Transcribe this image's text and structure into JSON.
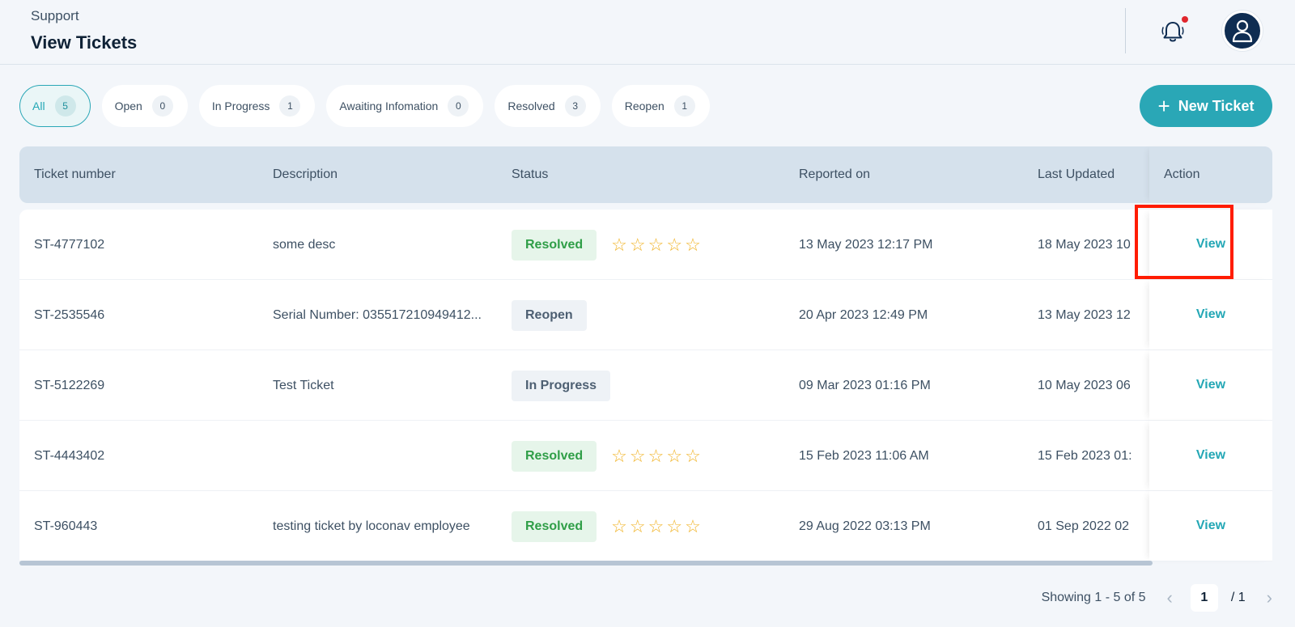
{
  "header": {
    "breadcrumb": "Support",
    "title": "View Tickets",
    "notification_icon": "bell-icon",
    "avatar_icon": "user-icon"
  },
  "filters": [
    {
      "label": "All",
      "count": "5",
      "active": true
    },
    {
      "label": "Open",
      "count": "0",
      "active": false
    },
    {
      "label": "In Progress",
      "count": "1",
      "active": false
    },
    {
      "label": "Awaiting Infomation",
      "count": "0",
      "active": false
    },
    {
      "label": "Resolved",
      "count": "3",
      "active": false
    },
    {
      "label": "Reopen",
      "count": "1",
      "active": false
    }
  ],
  "new_ticket_label": "New Ticket",
  "table": {
    "columns": [
      "Ticket number",
      "Description",
      "Status",
      "Reported on",
      "Last Updated",
      "Action"
    ],
    "rows": [
      {
        "number": "ST-4777102",
        "description": "some desc",
        "status": "Resolved",
        "rating_stars": 5,
        "reported": "13 May 2023 12:17 PM",
        "updated": "18 May 2023 10",
        "action": "View"
      },
      {
        "number": "ST-2535546",
        "description": "Serial Number: 035517210949412...",
        "status": "Reopen",
        "rating_stars": 0,
        "reported": "20 Apr 2023 12:49 PM",
        "updated": "13 May 2023 12",
        "action": "View"
      },
      {
        "number": "ST-5122269",
        "description": "Test Ticket",
        "status": "In Progress",
        "rating_stars": 0,
        "reported": "09 Mar 2023 01:16 PM",
        "updated": "10 May 2023 06",
        "action": "View"
      },
      {
        "number": "ST-4443402",
        "description": "",
        "status": "Resolved",
        "rating_stars": 5,
        "reported": "15 Feb 2023 11:06 AM",
        "updated": "15 Feb 2023 01:",
        "action": "View"
      },
      {
        "number": "ST-960443",
        "description": "testing ticket by loconav employee",
        "status": "Resolved",
        "rating_stars": 5,
        "reported": "29 Aug 2022 03:13 PM",
        "updated": "01 Sep 2022 02",
        "action": "View"
      }
    ]
  },
  "pagination": {
    "showing": "Showing 1 - 5 of 5",
    "current_page": "1",
    "total": "/ 1"
  },
  "colors": {
    "accent": "#2aa7b6",
    "resolved_bg": "#e6f5ea",
    "resolved_text": "#2f9e47",
    "highlight": "#ff1c00"
  }
}
